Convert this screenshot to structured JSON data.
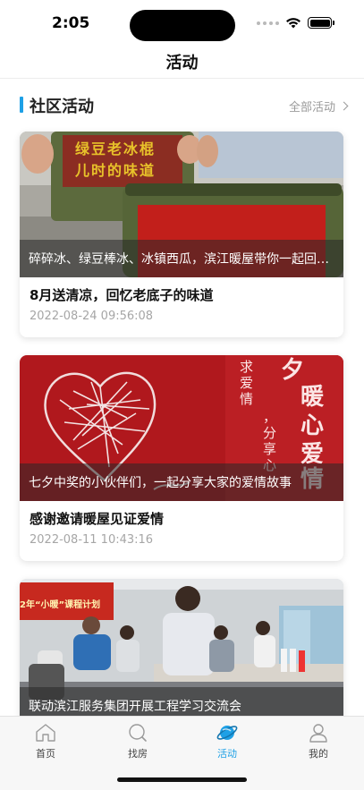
{
  "status_bar": {
    "time": "2:05"
  },
  "nav": {
    "title": "活动"
  },
  "section": {
    "title": "社区活动",
    "view_all": "全部活动"
  },
  "activities": [
    {
      "caption": "碎碎冰、绿豆棒冰、冰镇西瓜，滨江暖屋带你一起回忆老底子的味道",
      "title": "8月送清凉，回忆老底子的味道",
      "date": "2022-08-24 09:56:08",
      "image_text": [
        "绿豆老冰棍",
        "儿时的味道"
      ]
    },
    {
      "caption": "七夕中奖的小伙伴们，一起分享大家的爱情故事",
      "title": "感谢邀请暖屋见证爱情",
      "date": "2022-08-11 10:43:16",
      "image_text": [
        "夕",
        "暖",
        "心",
        "爱",
        "情",
        "求爱情",
        "，分享心"
      ]
    },
    {
      "caption": "联动滨江服务集团开展工程学习交流会",
      "title": "",
      "date": "",
      "image_text": [
        "2年“小暖”课程计划"
      ]
    }
  ],
  "tabs": [
    {
      "label": "首页",
      "icon": "home-icon",
      "active": false
    },
    {
      "label": "找房",
      "icon": "search-icon",
      "active": false
    },
    {
      "label": "活动",
      "icon": "planet-icon",
      "active": true
    },
    {
      "label": "我的",
      "icon": "user-icon",
      "active": false
    }
  ],
  "colors": {
    "accent": "#1ea0e6",
    "muted": "#a6a6a6",
    "red_banner": "#b0181d"
  }
}
